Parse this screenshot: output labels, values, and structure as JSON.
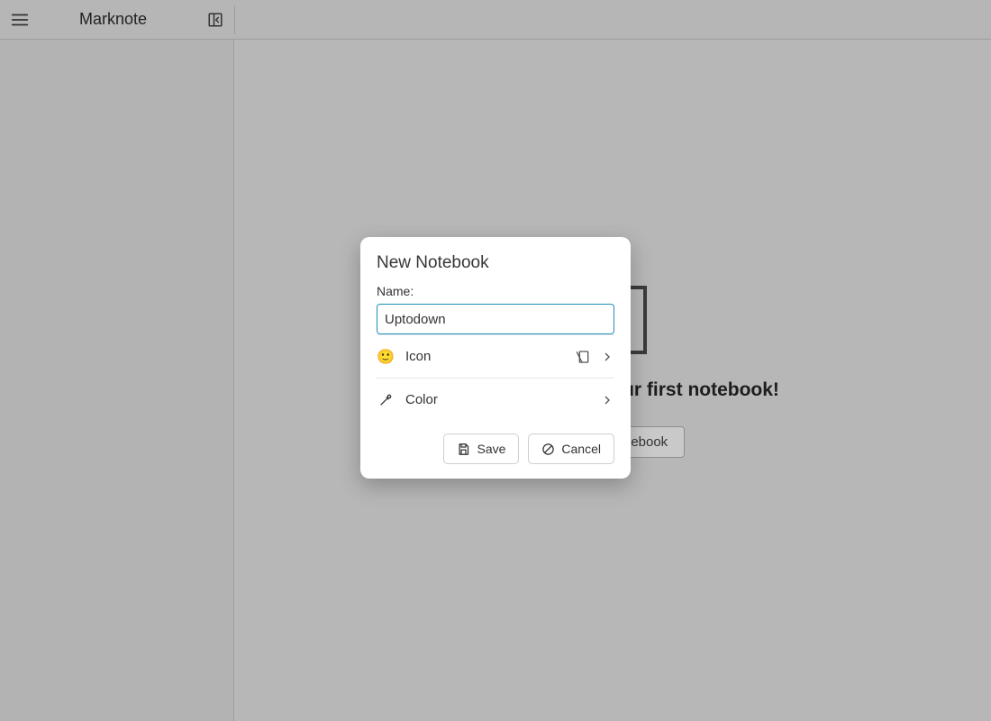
{
  "app": {
    "title": "Marknote"
  },
  "empty": {
    "headline": "Start by creating your first notebook!",
    "button_label": "New Notebook"
  },
  "dialog": {
    "title": "New Notebook",
    "name_label": "Name:",
    "name_value": "Uptodown",
    "icon_row_label": "Icon",
    "icon_emoji": "🙂",
    "color_row_label": "Color",
    "save_label": "Save",
    "cancel_label": "Cancel"
  }
}
